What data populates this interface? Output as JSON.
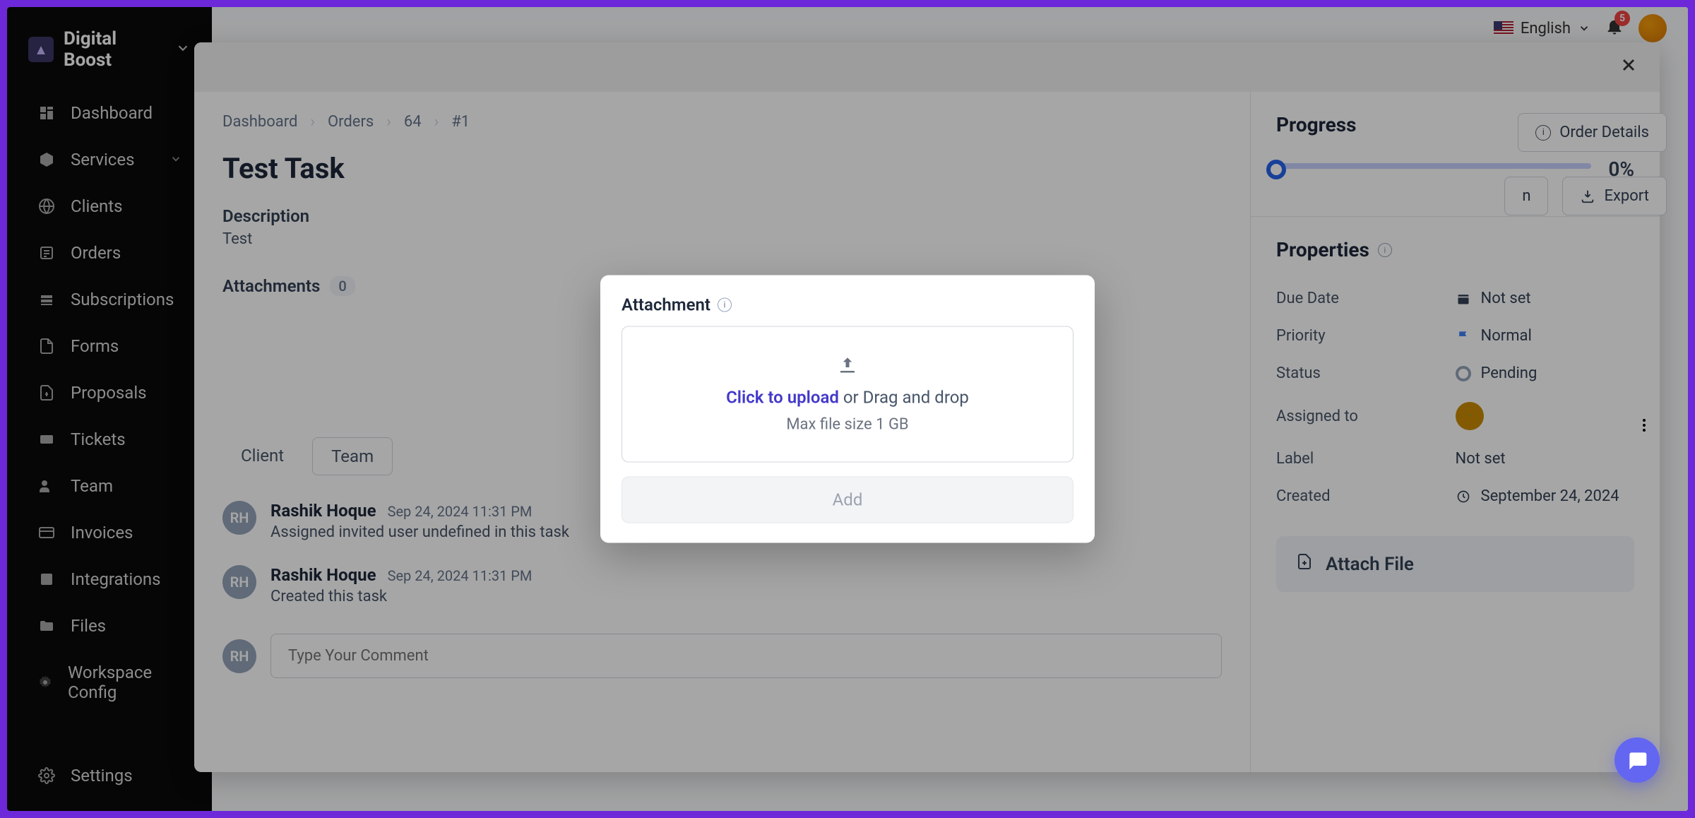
{
  "brand": {
    "name": "Digital Boost"
  },
  "sidebar": {
    "items": [
      {
        "label": "Dashboard",
        "id": "dashboard"
      },
      {
        "label": "Services",
        "id": "services",
        "has_submenu": true
      },
      {
        "label": "Clients",
        "id": "clients"
      },
      {
        "label": "Orders",
        "id": "orders"
      },
      {
        "label": "Subscriptions",
        "id": "subscriptions"
      },
      {
        "label": "Forms",
        "id": "forms"
      },
      {
        "label": "Proposals",
        "id": "proposals"
      },
      {
        "label": "Tickets",
        "id": "tickets"
      },
      {
        "label": "Team",
        "id": "team"
      },
      {
        "label": "Invoices",
        "id": "invoices"
      },
      {
        "label": "Integrations",
        "id": "integrations"
      },
      {
        "label": "Files",
        "id": "files"
      },
      {
        "label": "Workspace Config",
        "id": "workspace-config"
      }
    ],
    "bottom": {
      "label": "Settings"
    }
  },
  "topbar": {
    "language": "English",
    "notifications": "5"
  },
  "header_actions": {
    "order_details": "Order Details",
    "partial_n": "n",
    "export": "Export"
  },
  "breadcrumbs": [
    "Dashboard",
    "Orders",
    "64",
    "#1"
  ],
  "task": {
    "title": "Test Task",
    "description_label": "Description",
    "description": "Test",
    "attachments_label": "Attachments",
    "attachments_count": "0"
  },
  "tabs": {
    "client": "Client",
    "team": "Team"
  },
  "activity": [
    {
      "initials": "RH",
      "name": "Rashik Hoque",
      "time": "Sep 24, 2024 11:31 PM",
      "text": "Assigned invited user undefined in this task"
    },
    {
      "initials": "RH",
      "name": "Rashik Hoque",
      "time": "Sep 24, 2024 11:31 PM",
      "text": "Created this task"
    }
  ],
  "comment": {
    "placeholder": "Type Your Comment",
    "initials": "RH"
  },
  "progress": {
    "heading": "Progress",
    "percent": "0%"
  },
  "properties": {
    "heading": "Properties",
    "rows": {
      "due_date": {
        "key": "Due Date",
        "value": "Not set"
      },
      "priority": {
        "key": "Priority",
        "value": "Normal"
      },
      "status": {
        "key": "Status",
        "value": "Pending"
      },
      "assigned": {
        "key": "Assigned to",
        "value": ""
      },
      "label": {
        "key": "Label",
        "value": "Not set"
      },
      "created": {
        "key": "Created",
        "value": "September 24, 2024"
      }
    },
    "attach_file": "Attach File"
  },
  "attachment_modal": {
    "title": "Attachment",
    "click_to_upload": "Click to upload",
    "drag_drop": " or Drag and drop",
    "max_size": "Max file size 1 GB",
    "add_btn": "Add"
  }
}
